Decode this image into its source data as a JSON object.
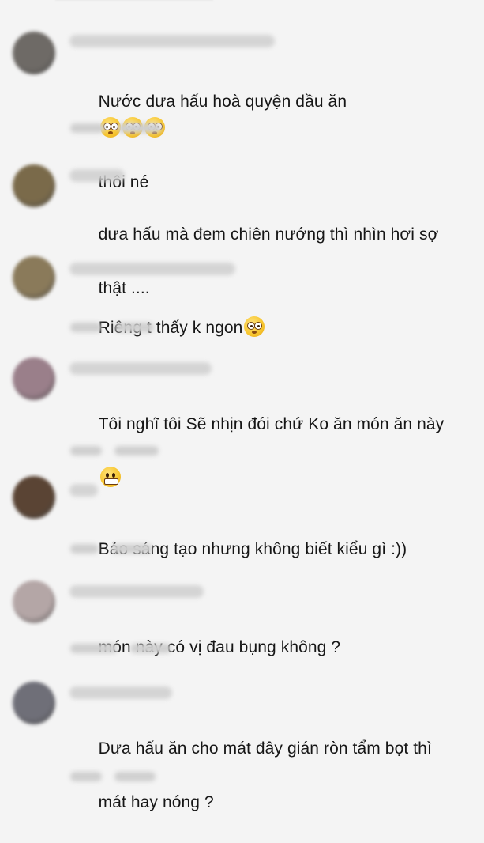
{
  "comments": [
    {
      "avatar_color": "#6e6a66",
      "line1": "Nước dưa hấu hoà quyện dầu ăn",
      "emoji_line1": [
        "flushed-face",
        "flushed-face",
        "flushed-face"
      ],
      "line2": "thôi né",
      "emoji_line2": []
    },
    {
      "avatar_color": "#7a6a4a",
      "line1": "dưa hấu mà đem chiên nướng thì nhìn hơi sợ",
      "emoji_line1": [],
      "line2": "thật ....",
      "emoji_line2": []
    },
    {
      "avatar_color": "#8a7a5a",
      "line1": "Riêng t thấy k ngon",
      "emoji_line1": [
        "flushed-face"
      ],
      "line2": "",
      "emoji_line2": []
    },
    {
      "avatar_color": "#9a7f8a",
      "line1": "Tôi nghĩ tôi Sẽ nhịn đói chứ Ko ăn món ăn này",
      "emoji_line1": [],
      "line2": "",
      "emoji_line2": [
        "grimacing-face"
      ]
    },
    {
      "avatar_color": "#5a4434",
      "line1": "Bảo sáng tạo nhưng không biết kiểu gì :))",
      "emoji_line1": [],
      "line2": "",
      "emoji_line2": []
    },
    {
      "avatar_color": "#b4a6a6",
      "line1": "món này có vị đau bụng không ?",
      "emoji_line1": [],
      "line2": "",
      "emoji_line2": []
    },
    {
      "avatar_color": "#6f6f78",
      "line1": "Dưa hấu ăn cho mát đây gián ròn tẩm bọt thì",
      "emoji_line1": [],
      "line2": "mát hay nóng ?",
      "emoji_line2": []
    }
  ]
}
